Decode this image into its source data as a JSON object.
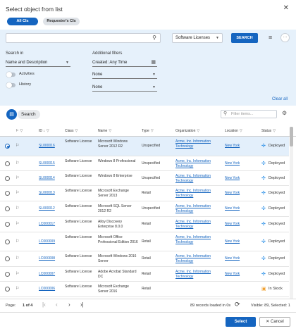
{
  "dialog": {
    "title": "Select object from list",
    "close_glyph": "✕",
    "scope_tabs": [
      {
        "label": "All CIs",
        "active": true
      },
      {
        "label": "Requester's CIs",
        "active": false
      }
    ]
  },
  "search": {
    "placeholder": "",
    "scope_value": "Software Licenses",
    "button_label": "SEARCH"
  },
  "filters": {
    "search_in_label": "Search in",
    "search_in_value": "Name and Description",
    "activities_label": "Activities",
    "history_label": "History",
    "additional_label": "Additional filters",
    "created_value": "Created: Any Time",
    "filter2_value": "None",
    "filter3_value": "None",
    "clear_all_label": "Clear all"
  },
  "grid": {
    "title": "Search",
    "filter_placeholder": "Filter items...",
    "columns": {
      "id": "ID",
      "class": "Class",
      "name": "Name",
      "type": "Type",
      "organization": "Organization",
      "location": "Location",
      "status": "Status"
    },
    "rows": [
      {
        "id": "SL000016",
        "class": "Software License",
        "name": "Microsoft Windows Server 2012 R2",
        "type": "Unspecified",
        "org": "Acme, Inc. Information Technology",
        "location": "New York",
        "status": "Deployed",
        "selected": true
      },
      {
        "id": "SL000015",
        "class": "Software License",
        "name": "Windows 8 Professional",
        "type": "Unspecified",
        "org": "Acme, Inc. Information Technology",
        "location": "New York",
        "status": "Deployed",
        "selected": false
      },
      {
        "id": "SL000014",
        "class": "Software License",
        "name": "Windows 8 Enterprise",
        "type": "Unspecified",
        "org": "Acme, Inc. Information Technology",
        "location": "New York",
        "status": "Deployed",
        "selected": false
      },
      {
        "id": "SL000013",
        "class": "Software License",
        "name": "Microsoft Exchange Server 2013",
        "type": "Retail",
        "org": "Acme, Inc. Information Technology",
        "location": "New York",
        "status": "Deployed",
        "selected": false
      },
      {
        "id": "SL000012",
        "class": "Software License",
        "name": "Microsoft SQL Server 2012 R2",
        "type": "Unspecified",
        "org": "Acme, Inc. Information Technology",
        "location": "New York",
        "status": "Deployed",
        "selected": false
      },
      {
        "id": "LC000017",
        "class": "Software License",
        "name": "Alloy Discovery Enterprise 8.0.0",
        "type": "Retail",
        "org": "Acme, Inc. Information Technology",
        "location": "New York",
        "status": "Deployed",
        "selected": false
      },
      {
        "id": "LC000009",
        "class": "Software License",
        "name": "Microsoft Office Professional Edition 2016",
        "type": "Retail",
        "org": "Acme, Inc. Information Technology",
        "location": "New York",
        "status": "Deployed",
        "selected": false
      },
      {
        "id": "LC000008",
        "class": "Software License",
        "name": "Microsoft Windows 2016 Server",
        "type": "Retail",
        "org": "Acme, Inc. Information Technology",
        "location": "New York",
        "status": "Deployed",
        "selected": false
      },
      {
        "id": "LC000007",
        "class": "Software License",
        "name": "Adobe Acrobat Standard DC",
        "type": "Retail",
        "org": "Acme, Inc. Information Technology",
        "location": "New York",
        "status": "Deployed",
        "selected": false
      },
      {
        "id": "LC000006",
        "class": "Software License",
        "name": "Microsoft Exchange Server 2016",
        "type": "Retail",
        "org": "",
        "location": "",
        "status": "In Stock",
        "selected": false
      }
    ]
  },
  "pager": {
    "page_label": "Page:",
    "page_value": "1 of 4",
    "records_loaded": "89 records loaded in 0s",
    "visible_label": "Visible: 89, Selected: 1"
  },
  "footer": {
    "select_label": "Select",
    "cancel_label": "Cancel"
  },
  "colors": {
    "primary": "#1565c0",
    "deployed_icon": "#1e88e5",
    "instock_icon": "#f0a030"
  }
}
